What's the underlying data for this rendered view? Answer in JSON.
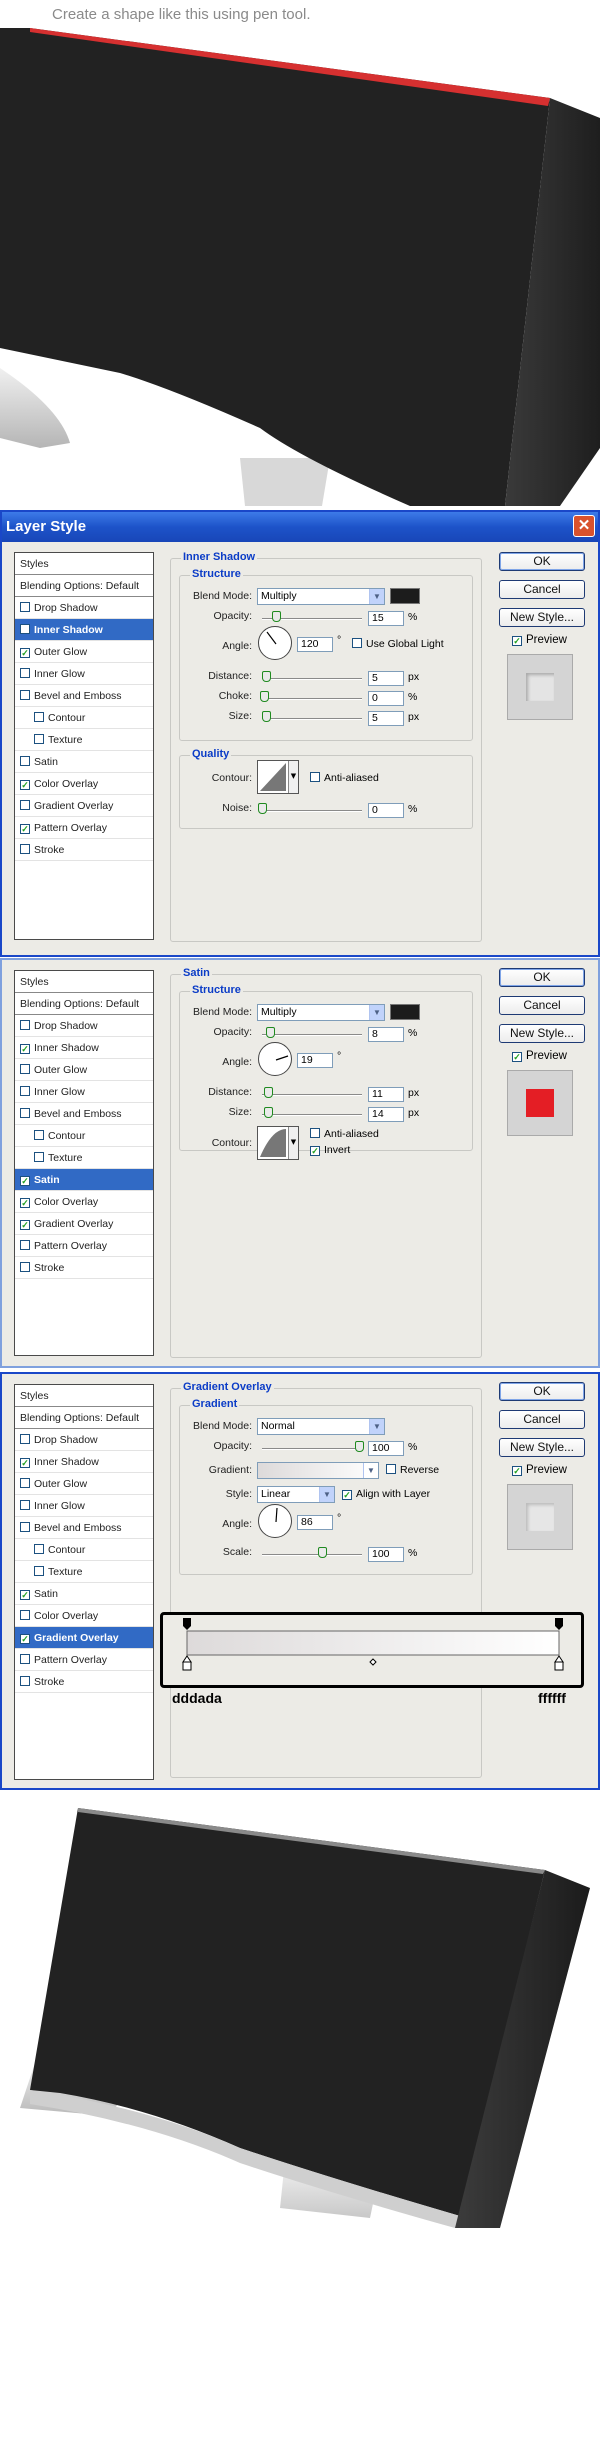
{
  "caption": "Create a shape like this using pen tool.",
  "dialog": {
    "title": "Layer Style",
    "close_glyph": "✕",
    "buttons": {
      "ok": "OK",
      "cancel": "Cancel",
      "new_style": "New Style...",
      "preview": "Preview"
    }
  },
  "styles_list": [
    "Styles",
    "Blending Options: Default",
    "Drop Shadow",
    "Inner Shadow",
    "Outer Glow",
    "Inner Glow",
    "Bevel and Emboss",
    "Contour",
    "Texture",
    "Satin",
    "Color Overlay",
    "Gradient Overlay",
    "Pattern Overlay",
    "Stroke"
  ],
  "panel1": {
    "checked": [
      false,
      false,
      true,
      false,
      false,
      false,
      false,
      false,
      true,
      false,
      true,
      false,
      false
    ],
    "selected": 3,
    "section": "Inner Shadow",
    "structure": "Structure",
    "blend_mode_label": "Blend Mode:",
    "blend_mode": "Multiply",
    "blend_color": "#1c1c1c",
    "opacity_label": "Opacity:",
    "opacity": "15",
    "angle_label": "Angle:",
    "angle": "120",
    "use_global": "Use Global Light",
    "distance_label": "Distance:",
    "distance": "5",
    "choke_label": "Choke:",
    "choke": "0",
    "size_label": "Size:",
    "size": "5",
    "quality": "Quality",
    "contour_label": "Contour:",
    "anti_aliased": "Anti-aliased",
    "noise_label": "Noise:",
    "noise": "0",
    "pct": "%",
    "px": "px",
    "deg": "°"
  },
  "panel2": {
    "checked": [
      false,
      true,
      false,
      false,
      false,
      false,
      false,
      true,
      true,
      true,
      false,
      false
    ],
    "selected": 9,
    "section": "Satin",
    "structure": "Structure",
    "blend_mode_label": "Blend Mode:",
    "blend_mode": "Multiply",
    "blend_color": "#1c1c1c",
    "opacity_label": "Opacity:",
    "opacity": "8",
    "angle_label": "Angle:",
    "angle": "19",
    "distance_label": "Distance:",
    "distance": "11",
    "size_label": "Size:",
    "size": "14",
    "contour_label": "Contour:",
    "anti_aliased": "Anti-aliased",
    "invert": "Invert",
    "pct": "%",
    "px": "px",
    "deg": "°",
    "preview_color": "#e41e25"
  },
  "panel3": {
    "checked": [
      false,
      true,
      false,
      false,
      false,
      false,
      false,
      true,
      false,
      true,
      false,
      false
    ],
    "selected": 11,
    "section": "Gradient Overlay",
    "gradient_sub": "Gradient",
    "blend_mode_label": "Blend Mode:",
    "blend_mode": "Normal",
    "opacity_label": "Opacity:",
    "opacity": "100",
    "gradient_label": "Gradient:",
    "reverse": "Reverse",
    "style_label": "Style:",
    "style": "Linear",
    "align": "Align with Layer",
    "angle_label": "Angle:",
    "angle": "86",
    "scale_label": "Scale:",
    "scale": "100",
    "pct": "%",
    "deg": "°",
    "stop_left": "dddada",
    "stop_right": "ffffff"
  }
}
